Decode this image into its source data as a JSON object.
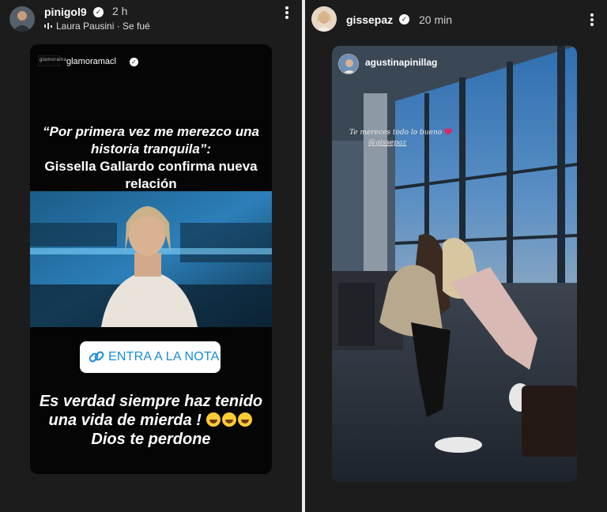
{
  "left_story": {
    "username": "pinigol9",
    "time": "2 h",
    "music": "Laura Pausini · Se fué",
    "card": {
      "account": "glamoramacl",
      "logo_text": "glamorama",
      "headline_quote": "“Por primera vez me merezco una historia tranquila”:",
      "headline_rest": "Gissella Gallardo confirma nueva relación",
      "cta_label": "ENTRA A LA NOTA",
      "comment_line1": "Es verdad siempre haz tenido una vida de mierda !",
      "comment_line2": "Dios te perdone"
    }
  },
  "right_story": {
    "username": "gissepaz",
    "time": "20 min",
    "card": {
      "account": "agustinapinillag",
      "caption_line1": "Te mereces todo lo bueno",
      "caption_line2": "@gissepaz"
    }
  },
  "icons": {
    "verified": "verified-badge-icon",
    "more": "more-options-icon",
    "music": "music-icon",
    "link": "link-icon",
    "heart": "heart-icon"
  },
  "colors": {
    "panel_bg": "#1c1c1c",
    "cta_text": "#1a8cd8",
    "heart": "#e0245e"
  }
}
